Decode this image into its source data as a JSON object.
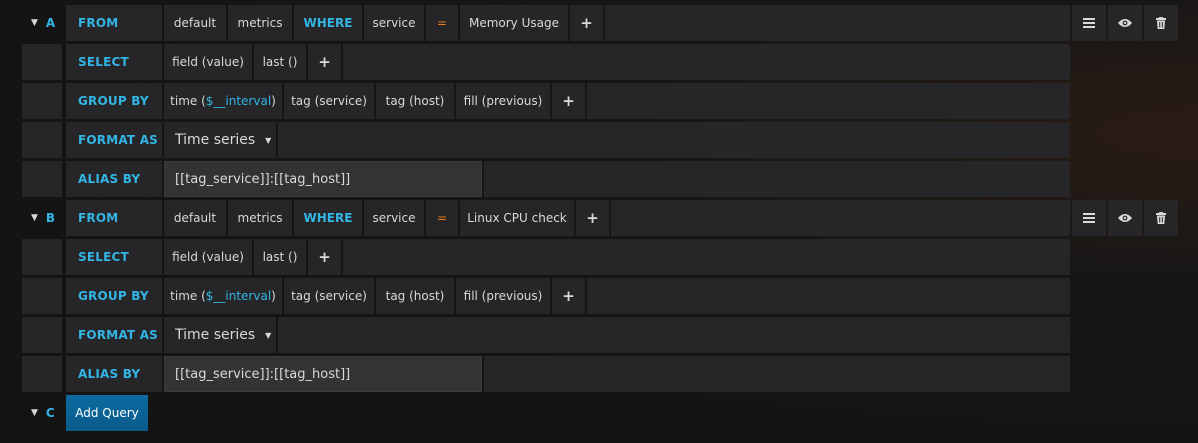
{
  "queries": [
    {
      "ref": "A",
      "from_label": "FROM",
      "policy": "default",
      "measurement": "metrics",
      "where_label": "WHERE",
      "tag_key": "service",
      "operator": "=",
      "tag_value": "Memory Usage",
      "select_label": "SELECT",
      "select_field": "field (value)",
      "select_fn": "last ()",
      "group_label": "GROUP BY",
      "group_time_prefix": "time (",
      "group_time_var": "$__interval",
      "group_time_suffix": ")",
      "group_tag1": "tag (service)",
      "group_tag2": "tag (host)",
      "group_fill": "fill (previous)",
      "format_label": "FORMAT AS",
      "format_value": "Time series",
      "alias_label": "ALIAS BY",
      "alias_value": "[[tag_service]]:[[tag_host]]"
    },
    {
      "ref": "B",
      "from_label": "FROM",
      "policy": "default",
      "measurement": "metrics",
      "where_label": "WHERE",
      "tag_key": "service",
      "operator": "=",
      "tag_value": "Linux CPU check",
      "select_label": "SELECT",
      "select_field": "field (value)",
      "select_fn": "last ()",
      "group_label": "GROUP BY",
      "group_time_prefix": "time (",
      "group_time_var": "$__interval",
      "group_time_suffix": ")",
      "group_tag1": "tag (service)",
      "group_tag2": "tag (host)",
      "group_fill": "fill (previous)",
      "format_label": "FORMAT AS",
      "format_value": "Time series",
      "alias_label": "ALIAS BY",
      "alias_value": "[[tag_service]]:[[tag_host]]"
    }
  ],
  "add_query": {
    "ref": "C",
    "label": "Add Query"
  },
  "icons": {
    "plus": "+",
    "menu": "menu-icon",
    "eye": "eye-icon",
    "trash": "trash-icon",
    "caret": "caret-down-icon"
  },
  "colors": {
    "keyword": "#33b5e5",
    "operator": "#eb7b18",
    "segment_bg": "#262628",
    "button_bg": "#0d6aa0"
  }
}
